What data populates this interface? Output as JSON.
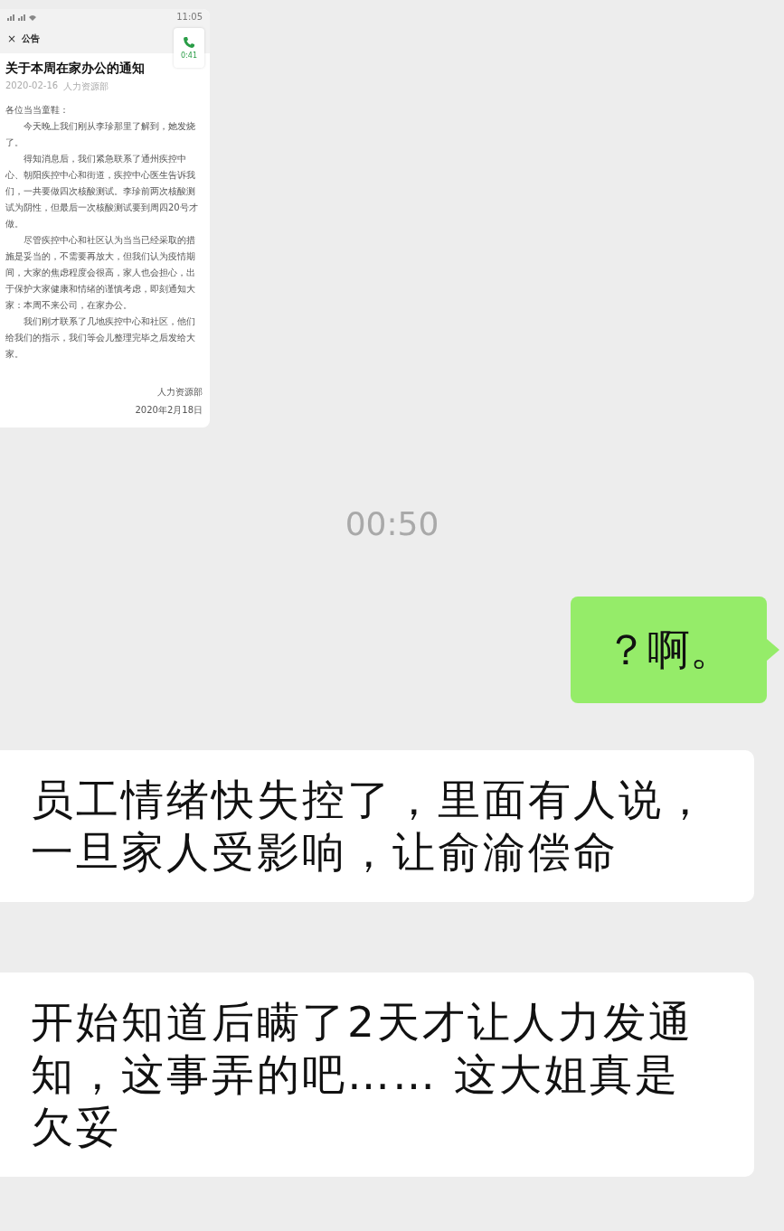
{
  "messages": [
    {
      "kind": "image",
      "outgoing": false,
      "shared_screen": {
        "status_bar": {
          "time": "11:05"
        },
        "header": {
          "close": "×",
          "title": "公告"
        },
        "call_widget": {
          "duration": "0:41"
        },
        "article": {
          "title": "关于本周在家办公的通知",
          "date": "2020-02-16",
          "author": "人力资源部",
          "greeting": "各位当当童鞋：",
          "paragraphs": [
            "今天晚上我们刚从李珍那里了解到，她发烧了。",
            "得知消息后，我们紧急联系了通州疾控中心、朝阳疾控中心和街道，疾控中心医生告诉我们，一共要做四次核酸测试。李珍前两次核酸测试为阴性，但最后一次核酸测试要到周四20号才做。",
            "尽管疾控中心和社区认为当当已经采取的措施是妥当的，不需要再放大，但我们认为疫情期间，大家的焦虑程度会很高，家人也会担心，出于保护大家健康和情绪的谨慎考虑，即刻通知大家：本周不来公司，在家办公。",
            "我们刚才联系了几地疾控中心和社区，他们给我们的指示，我们等会儿整理完毕之后发给大家。"
          ],
          "signature": "人力资源部",
          "signed_date": "2020年2月18日"
        }
      }
    },
    {
      "kind": "time",
      "text": "00:50"
    },
    {
      "kind": "text",
      "outgoing": true,
      "text": "？啊。"
    },
    {
      "kind": "text",
      "outgoing": false,
      "text": "员工情绪快失控了，里面有人说，一旦家人受影响，让俞渝偿命"
    },
    {
      "kind": "text",
      "outgoing": false,
      "text": "开始知道后瞒了2天才让人力发通知，这事弄的吧…… 这大姐真是欠妥"
    }
  ]
}
